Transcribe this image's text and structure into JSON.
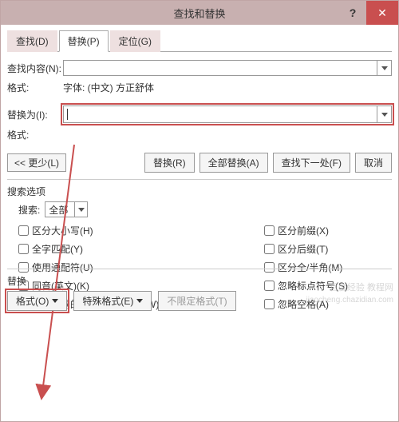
{
  "titlebar": {
    "title": "查找和替换",
    "help": "?",
    "close": "✕"
  },
  "tabs": {
    "find": "查找(D)",
    "replace": "替换(P)",
    "goto": "定位(G)"
  },
  "find": {
    "label": "查找内容(N):",
    "value": "",
    "format_label": "格式:",
    "format_value": "字体: (中文) 方正舒体"
  },
  "replace": {
    "label": "替换为(I):",
    "value": "",
    "format_label": "格式:",
    "format_value": ""
  },
  "buttons": {
    "less": "<< 更少(L)",
    "do_replace": "替换(R)",
    "replace_all": "全部替换(A)",
    "find_next": "查找下一处(F)",
    "cancel": "取消"
  },
  "search_options": {
    "title": "搜索选项",
    "search_label": "搜索:",
    "search_value": "全部",
    "left": [
      "区分大小写(H)",
      "全字匹配(Y)",
      "使用通配符(U)",
      "同音(英文)(K)",
      "查找单词的所有形式(英文)(W)"
    ],
    "right": [
      "区分前缀(X)",
      "区分后缀(T)",
      "区分全/半角(M)",
      "忽略标点符号(S)",
      "忽略空格(A)"
    ]
  },
  "bottom": {
    "section": "替换",
    "format_btn": "格式(O)",
    "special_btn": "特殊格式(E)",
    "no_format_btn": "不限定格式(T)"
  },
  "watermark": {
    "w1": "百度经验 教程网",
    "w2": "jiaocheng.chazidian.com"
  }
}
